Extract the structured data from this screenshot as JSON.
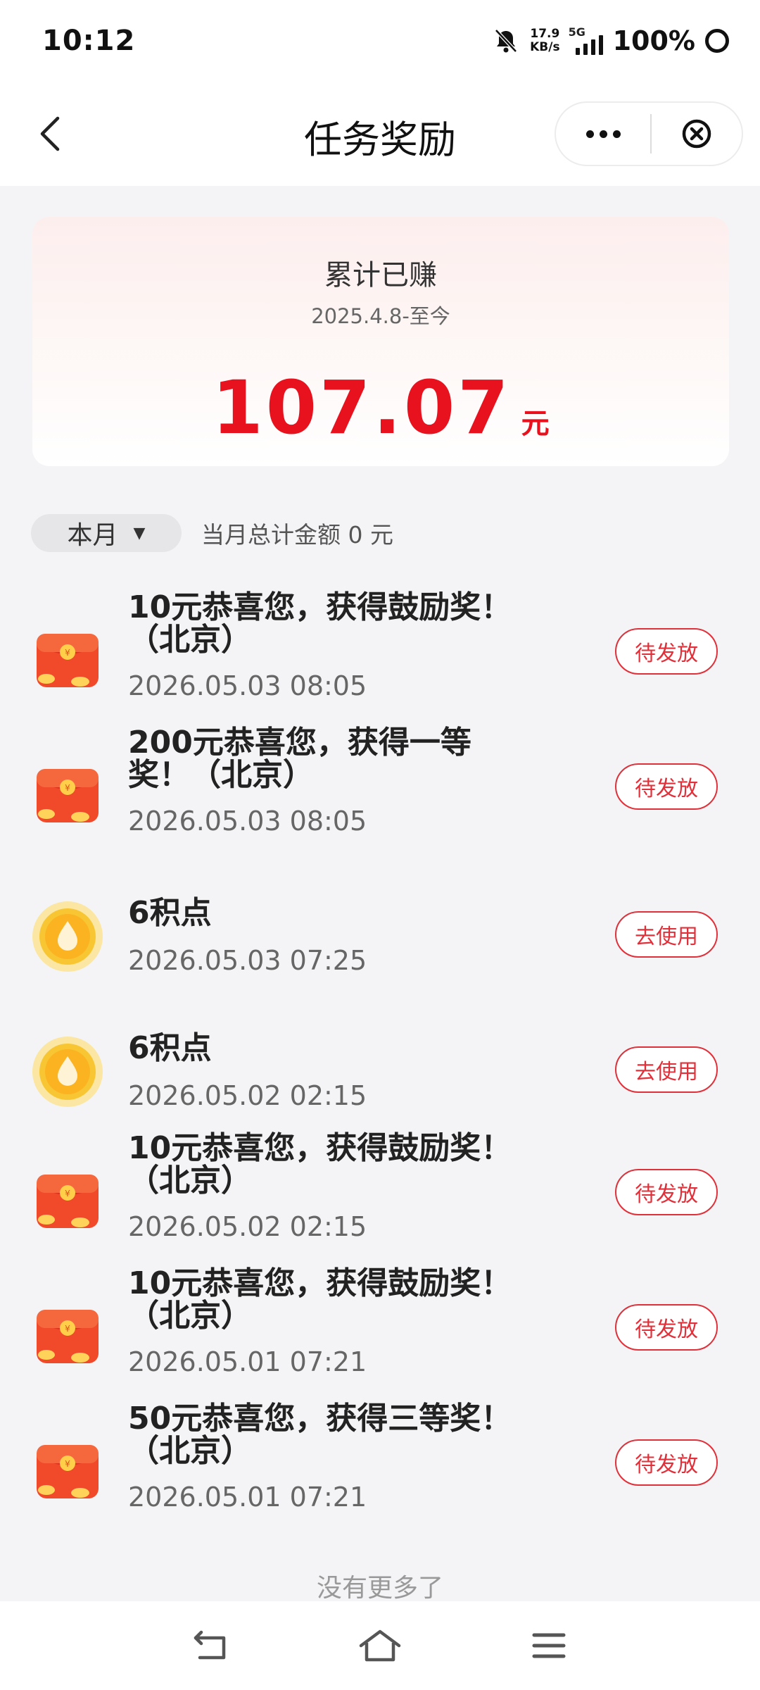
{
  "status": {
    "time": "10:12",
    "net_speed_value": "17.9",
    "net_speed_unit": "KB/s",
    "network": "5G",
    "battery": "100%"
  },
  "header": {
    "title": "任务奖励"
  },
  "summary": {
    "label": "累计已赚",
    "range": "2025.4.8-至今",
    "amount": "107.07",
    "unit": "元"
  },
  "filter": {
    "month": "本月",
    "month_total": "当月总计金额  0  元"
  },
  "rewards": [
    {
      "icon": "red-envelope-icon",
      "title": "10元恭喜您，获得鼓励奖！（北京）",
      "time": "2026.05.03 08:05",
      "action": "待发放"
    },
    {
      "icon": "red-envelope-icon",
      "title": "200元恭喜您，获得一等奖！（北京）",
      "time": "2026.05.03 08:05",
      "action": "待发放"
    },
    {
      "icon": "points-drop-icon",
      "title": "6积点",
      "time": "2026.05.03 07:25",
      "action": "去使用"
    },
    {
      "icon": "points-drop-icon",
      "title": "6积点",
      "time": "2026.05.02 02:15",
      "action": "去使用"
    },
    {
      "icon": "red-envelope-icon",
      "title": "10元恭喜您，获得鼓励奖！（北京）",
      "time": "2026.05.02 02:15",
      "action": "待发放"
    },
    {
      "icon": "red-envelope-icon",
      "title": "10元恭喜您，获得鼓励奖！（北京）",
      "time": "2026.05.01 07:21",
      "action": "待发放"
    },
    {
      "icon": "red-envelope-icon",
      "title": "50元恭喜您，获得三等奖！（北京）",
      "time": "2026.05.01 07:21",
      "action": "待发放"
    }
  ],
  "footer": {
    "no_more": "没有更多了"
  },
  "colors": {
    "accent_red": "#e8121f",
    "button_red": "#e0303a",
    "background": "#f4f4f6"
  }
}
